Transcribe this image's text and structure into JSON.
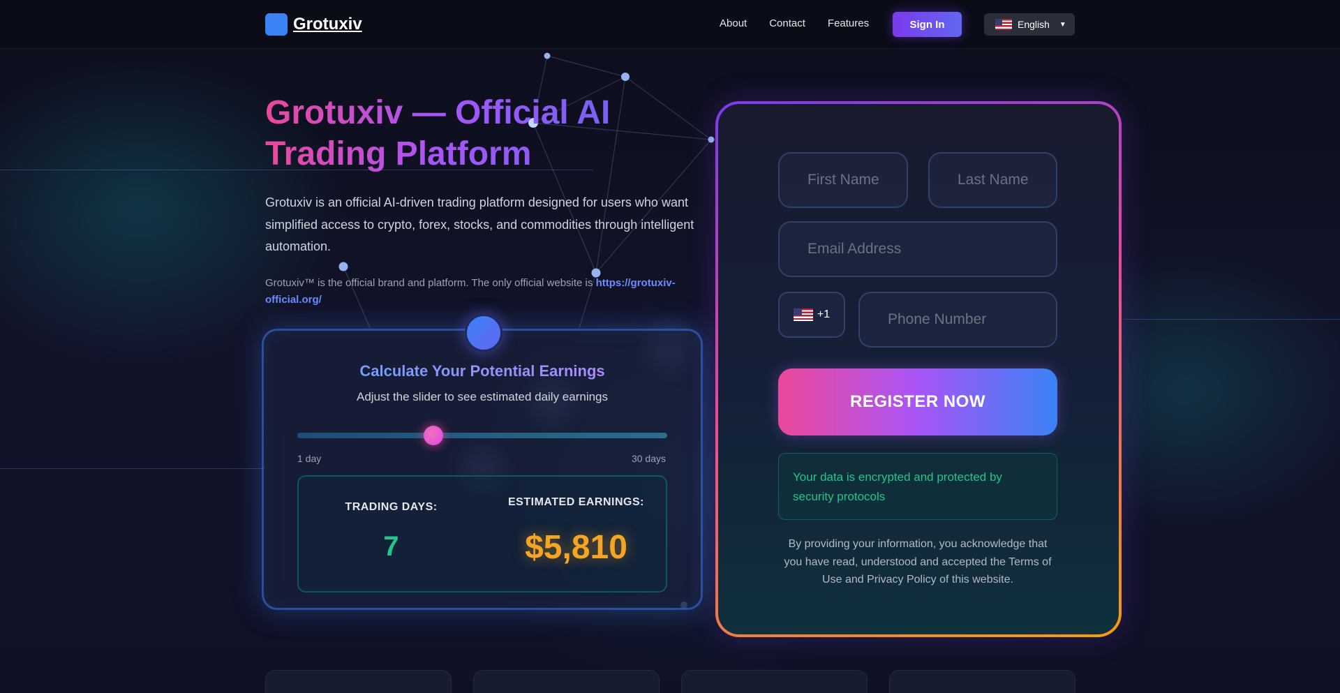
{
  "nav": {
    "logo_icon": "",
    "brand": "Grotuxiv",
    "links": [
      "About",
      "Contact",
      "Features"
    ],
    "signin_label": "Sign In",
    "language": "English",
    "language_caret": "▼",
    "flag_icon": "us-flag-icon"
  },
  "hero": {
    "title": "Grotuxiv — Official AI Trading Platform",
    "description": "Grotuxiv is an official AI-driven trading platform designed for users who want simplified access to crypto, forex, stocks, and commodities through intelligent automation.",
    "note_text": "Grotuxiv™ is the official brand and platform. The only official website is ",
    "note_link": "https://grotuxiv-official.org/"
  },
  "calculator": {
    "icon": "",
    "title": "Calculate Your Potential Earnings",
    "subtitle": "Adjust the slider to see estimated daily earnings",
    "slider": {
      "min_label": "1 day",
      "max_label": "30 days",
      "min": 1,
      "max": 30,
      "value": 7
    },
    "days_label": "TRADING DAYS:",
    "days_value": "7",
    "earnings_label": "ESTIMATED EARNINGS:",
    "earnings_value": "$5,810"
  },
  "form": {
    "first_name_placeholder": "First Name",
    "last_name_placeholder": "Last Name",
    "email_placeholder": "Email Address",
    "country_code": "+1",
    "phone_placeholder": "Phone Number",
    "register_label": "REGISTER NOW",
    "secure_icon": "",
    "secure_text": "Your data is encrypted and protected by security protocols",
    "disclaimer": "By providing your information, you acknowledge that you have read, understood and accepted the Terms of Use and Privacy Policy of this website."
  },
  "colors": {
    "accent_purple": "#7c3aed",
    "accent_pink": "#ec4899",
    "accent_blue": "#3b82f6",
    "success_green": "#22c58b",
    "earnings_gold": "#f5a524"
  }
}
